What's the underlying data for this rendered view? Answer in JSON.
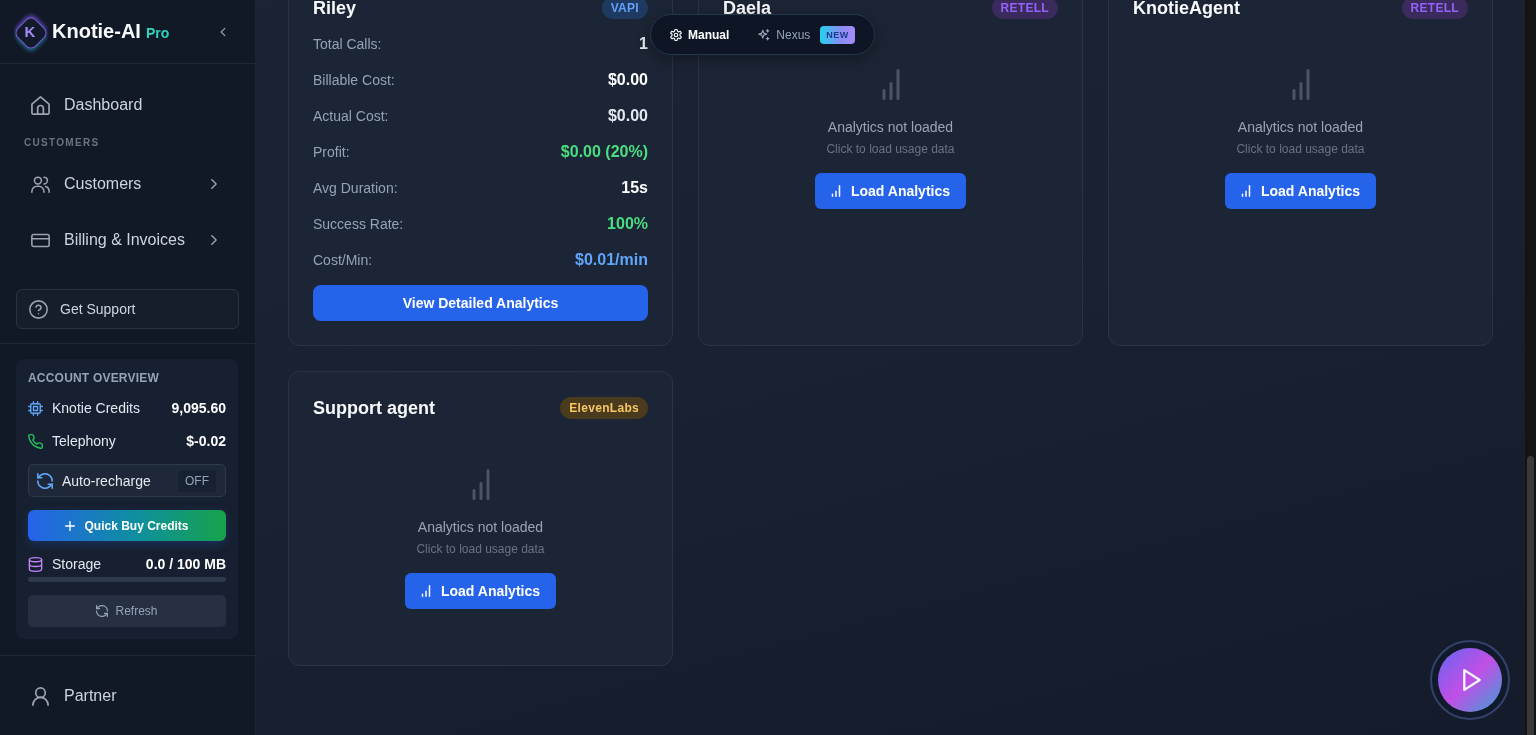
{
  "sidebar": {
    "brand": {
      "letter": "K",
      "name": "Knotie-AI",
      "plan": "Pro"
    },
    "nav": [
      {
        "kind": "link",
        "label": "Dashboard",
        "has_submenu": false,
        "selected": false
      },
      {
        "kind": "section",
        "label": "CUSTOMERS"
      },
      {
        "kind": "link",
        "label": "Customers",
        "has_submenu": true,
        "selected": false
      },
      {
        "kind": "link",
        "label": "Billing & Invoices",
        "has_submenu": true,
        "selected": false
      }
    ],
    "support_button": "Get Support",
    "account_overview": {
      "title": "ACCOUNT OVERVIEW",
      "balances": [
        {
          "label": "Knotie Credits",
          "value": "9,095.60"
        },
        {
          "label": "Telephony",
          "value": "$-0.02"
        }
      ],
      "auto_recharge": {
        "label": "Auto-recharge",
        "status": "OFF",
        "on": false
      },
      "buy_button": "Quick Buy Credits",
      "storage": {
        "label": "Storage",
        "value": "0.0 / 100 MB",
        "level": 0
      },
      "refresh_button": "Refresh"
    },
    "footer_nav": [
      {
        "label": "Partner",
        "selected": false
      }
    ]
  },
  "mode_switch": {
    "options": [
      {
        "label": "Manual",
        "selected": true
      },
      {
        "label": "Nexus",
        "selected": false,
        "badge": "NEW"
      }
    ]
  },
  "agents": [
    {
      "kind": "stats",
      "name": "Riley",
      "provider": "VAPI",
      "color": "#1f3a60",
      "stats": [
        {
          "label": "Total Calls:",
          "value": "1",
          "kind": "plain"
        },
        {
          "label": "Billable Cost:",
          "value": "$0.00",
          "kind": "strong"
        },
        {
          "label": "Actual Cost:",
          "value": "$0.00",
          "kind": "plain"
        },
        {
          "label": "Profit:",
          "value": "$0.00 (20%)",
          "kind": "positive"
        },
        {
          "label": "Avg Duration:",
          "value": "15s",
          "kind": "strong"
        },
        {
          "label": "Success Rate:",
          "value": "100%",
          "kind": "positive"
        },
        {
          "label": "Cost/Min:",
          "value": "$0.01/min",
          "kind": "accent"
        }
      ],
      "button": "View Detailed Analytics"
    },
    {
      "kind": "empty",
      "name": "Daela",
      "provider": "RETELL",
      "color": "#3b2a5c",
      "status": "Analytics not loaded",
      "hint": "Click to load usage data",
      "button": "Load Analytics"
    },
    {
      "kind": "empty",
      "name": "KnotieAgent",
      "provider": "RETELL",
      "color": "#3b2a5c",
      "status": "Analytics not loaded",
      "hint": "Click to load usage data",
      "button": "Load Analytics"
    },
    {
      "kind": "empty",
      "name": "Support agent",
      "provider": "ElevenLabs",
      "color": "#4a3b1e",
      "status": "Analytics not loaded",
      "hint": "Click to load usage data",
      "button": "Load Analytics"
    }
  ]
}
